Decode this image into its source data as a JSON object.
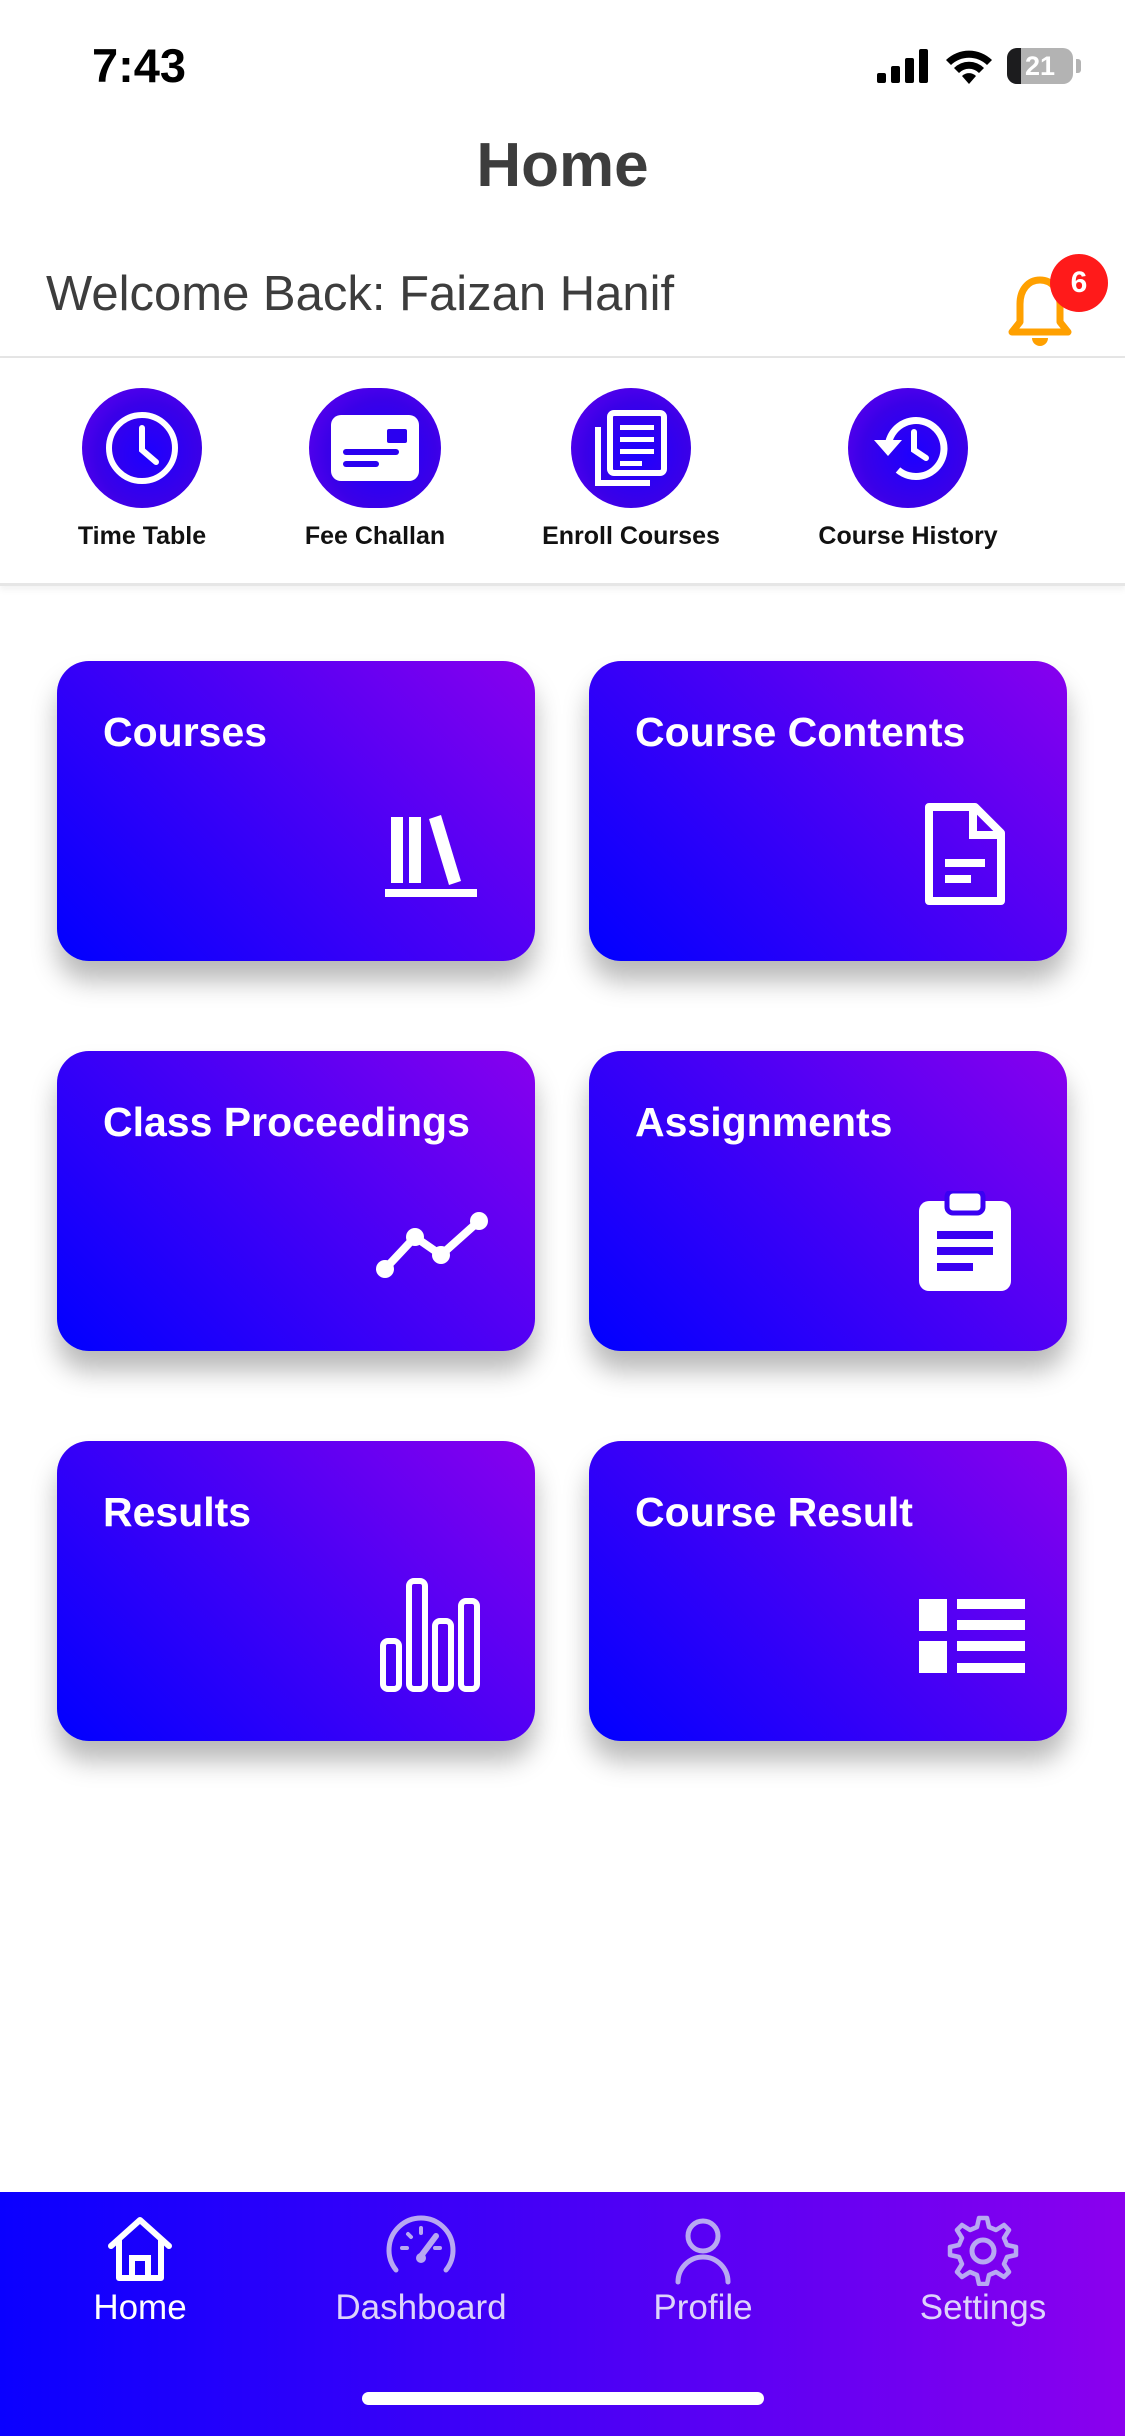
{
  "status_bar": {
    "time": "7:43",
    "battery": "21",
    "battery_level_percent": 21
  },
  "header": {
    "title": "Home"
  },
  "welcome": {
    "text": "Welcome Back: Faizan Hanif"
  },
  "notifications": {
    "count": "6",
    "bell_color": "#FFA000",
    "badge_color": "#FF1A1A"
  },
  "quick_actions": [
    {
      "label": "Time Table",
      "icon": "clock-icon"
    },
    {
      "label": "Fee Challan",
      "icon": "id-card-icon"
    },
    {
      "label": "Enroll Courses",
      "icon": "copy-document-icon"
    },
    {
      "label": "Course History",
      "icon": "history-icon"
    }
  ],
  "cards": [
    {
      "title": "Courses",
      "icon": "books-icon"
    },
    {
      "title": "Course Contents",
      "icon": "document-icon"
    },
    {
      "title": "Class Proceedings",
      "icon": "trend-line-icon"
    },
    {
      "title": "Assignments",
      "icon": "clipboard-icon"
    },
    {
      "title": "Results",
      "icon": "bar-chart-icon"
    },
    {
      "title": "Course Result",
      "icon": "list-icon"
    }
  ],
  "bottom_nav": [
    {
      "label": "Home",
      "icon": "home-icon",
      "active": true
    },
    {
      "label": "Dashboard",
      "icon": "speedometer-icon",
      "active": false
    },
    {
      "label": "Profile",
      "icon": "person-icon",
      "active": false
    },
    {
      "label": "Settings",
      "icon": "gear-icon",
      "active": false
    }
  ],
  "colors": {
    "gradient_start": "#0000FF",
    "gradient_end": "#8800EE",
    "nav_inactive": "#B8A8F2",
    "nav_active": "#FFFFFF"
  }
}
